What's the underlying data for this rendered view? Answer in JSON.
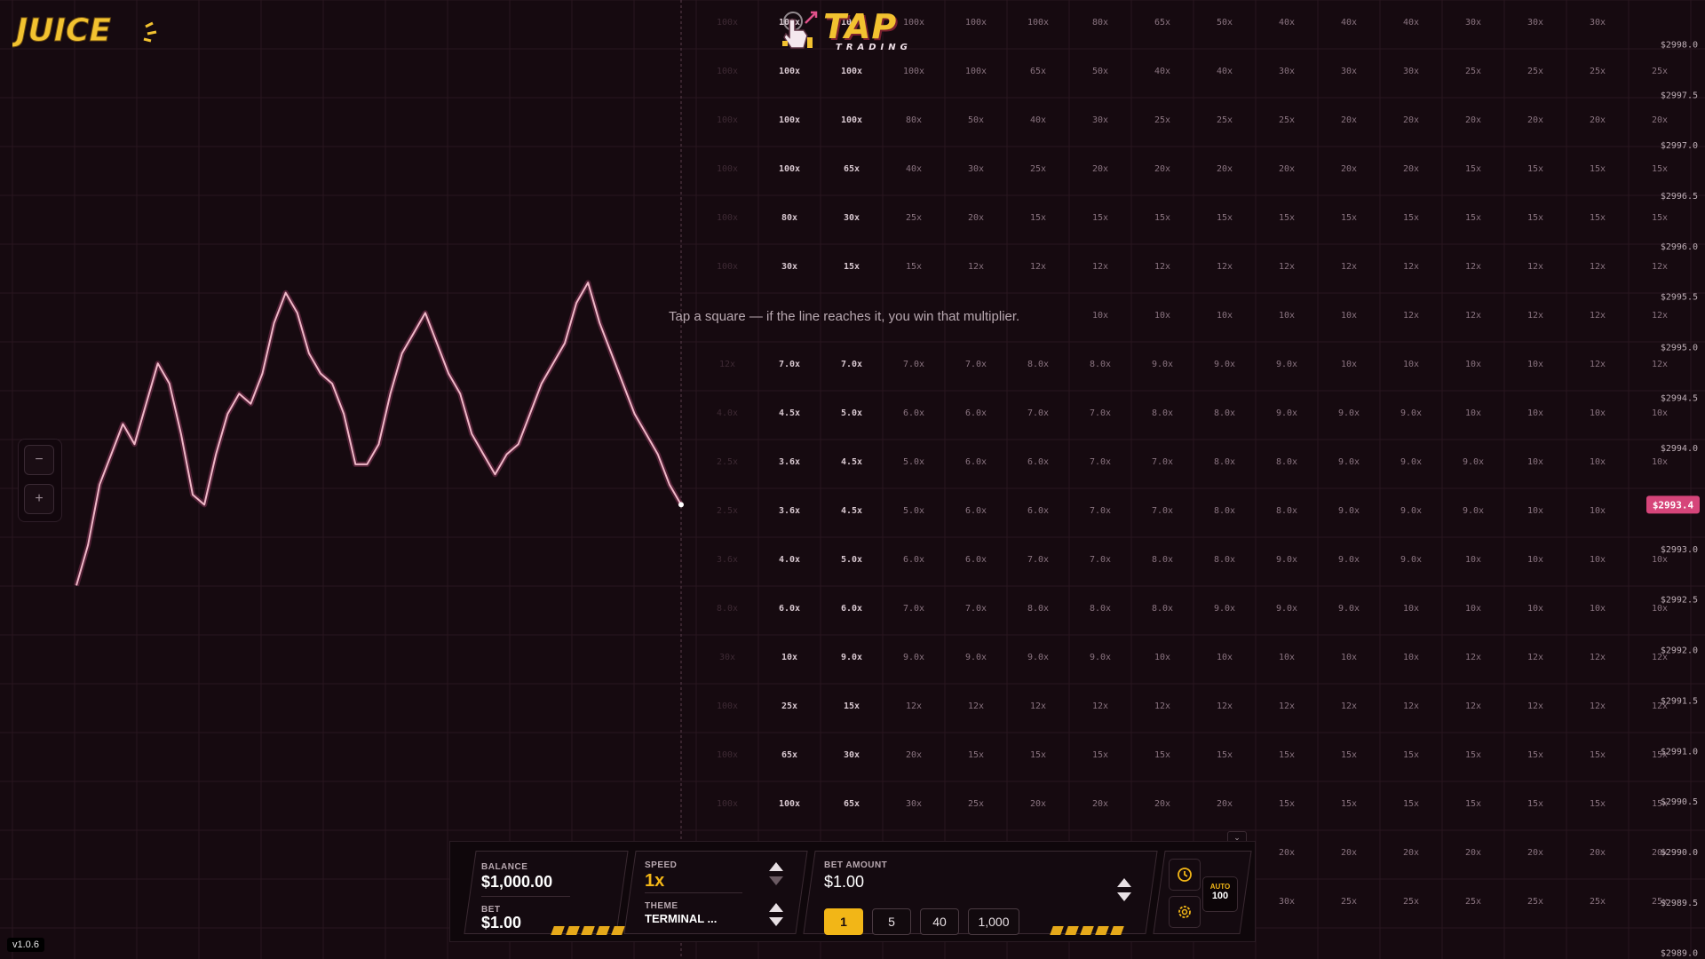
{
  "header": {
    "juice_logo_text": "JUICE",
    "tap_logo_text": "TAP",
    "tap_logo_sub": "TRADING"
  },
  "hint": "Tap a square — if the line reaches it, you win that multiplier.",
  "version": "v1.0.6",
  "current_price": "$2993.4",
  "price_labels": [
    "$2998.0",
    "$2997.5",
    "$2997.0",
    "$2996.5",
    "$2996.0",
    "$2995.5",
    "$2995.0",
    "$2994.5",
    "$2994.0",
    "$2993.0",
    "$2992.5",
    "$2992.0",
    "$2991.5",
    "$2991.0",
    "$2990.5",
    "$2990.0",
    "$2989.5",
    "$2989.0"
  ],
  "multiplier_rows": [
    [
      "100x",
      "100x",
      "100x",
      "100x",
      "100x",
      "80x",
      "65x",
      "50x",
      "40x",
      "40x",
      "40x",
      "30x",
      "30x",
      "30x"
    ],
    [
      "100x",
      "100x",
      "100x",
      "100x",
      "65x",
      "50x",
      "40x",
      "40x",
      "30x",
      "30x",
      "30x",
      "25x",
      "25x",
      "25x",
      "25x"
    ],
    [
      "100x",
      "100x",
      "80x",
      "50x",
      "40x",
      "30x",
      "25x",
      "25x",
      "25x",
      "20x",
      "20x",
      "20x",
      "20x",
      "20x",
      "20x"
    ],
    [
      "100x",
      "65x",
      "40x",
      "30x",
      "25x",
      "20x",
      "20x",
      "20x",
      "20x",
      "20x",
      "20x",
      "15x",
      "15x",
      "15x",
      "15x"
    ],
    [
      "80x",
      "30x",
      "25x",
      "20x",
      "15x",
      "15x",
      "15x",
      "15x",
      "15x",
      "15x",
      "15x",
      "15x",
      "15x",
      "15x",
      "15x"
    ],
    [
      "30x",
      "15x",
      "15x",
      "12x",
      "12x",
      "12x",
      "12x",
      "12x",
      "12x",
      "12x",
      "12x",
      "12x",
      "12x",
      "12x",
      "12x"
    ],
    [
      "",
      "",
      "",
      "",
      "",
      "10x",
      "10x",
      "10x",
      "10x",
      "10x",
      "12x",
      "12x",
      "12x",
      "12x",
      "12x"
    ],
    [
      "7.0x",
      "7.0x",
      "7.0x",
      "7.0x",
      "8.0x",
      "8.0x",
      "9.0x",
      "9.0x",
      "9.0x",
      "10x",
      "10x",
      "10x",
      "10x",
      "12x",
      "12x"
    ],
    [
      "4.5x",
      "5.0x",
      "6.0x",
      "6.0x",
      "7.0x",
      "7.0x",
      "8.0x",
      "8.0x",
      "9.0x",
      "9.0x",
      "9.0x",
      "10x",
      "10x",
      "10x",
      "10x"
    ],
    [
      "3.6x",
      "4.5x",
      "5.0x",
      "6.0x",
      "6.0x",
      "7.0x",
      "7.0x",
      "8.0x",
      "8.0x",
      "9.0x",
      "9.0x",
      "9.0x",
      "10x",
      "10x",
      "10x"
    ],
    [
      "3.6x",
      "4.5x",
      "5.0x",
      "6.0x",
      "6.0x",
      "7.0x",
      "7.0x",
      "8.0x",
      "8.0x",
      "9.0x",
      "9.0x",
      "9.0x",
      "10x",
      "10x",
      "10x"
    ],
    [
      "4.0x",
      "5.0x",
      "6.0x",
      "6.0x",
      "7.0x",
      "7.0x",
      "8.0x",
      "8.0x",
      "9.0x",
      "9.0x",
      "9.0x",
      "10x",
      "10x",
      "10x",
      "10x"
    ],
    [
      "6.0x",
      "6.0x",
      "7.0x",
      "7.0x",
      "8.0x",
      "8.0x",
      "8.0x",
      "9.0x",
      "9.0x",
      "9.0x",
      "10x",
      "10x",
      "10x",
      "10x",
      "10x"
    ],
    [
      "10x",
      "9.0x",
      "9.0x",
      "9.0x",
      "9.0x",
      "9.0x",
      "10x",
      "10x",
      "10x",
      "10x",
      "10x",
      "12x",
      "12x",
      "12x",
      "12x"
    ],
    [
      "25x",
      "15x",
      "12x",
      "12x",
      "12x",
      "12x",
      "12x",
      "12x",
      "12x",
      "12x",
      "12x",
      "12x",
      "12x",
      "12x",
      "12x"
    ],
    [
      "65x",
      "30x",
      "20x",
      "15x",
      "15x",
      "15x",
      "15x",
      "15x",
      "15x",
      "15x",
      "15x",
      "15x",
      "15x",
      "15x",
      "15x"
    ],
    [
      "100x",
      "65x",
      "30x",
      "25x",
      "20x",
      "20x",
      "20x",
      "20x",
      "15x",
      "15x",
      "15x",
      "15x",
      "15x",
      "15x",
      "15x"
    ],
    [
      "",
      "",
      "",
      "",
      "",
      "",
      "",
      "",
      "20x",
      "20x",
      "20x",
      "20x",
      "20x",
      "20x",
      "20x"
    ],
    [
      "",
      "",
      "",
      "",
      "",
      "",
      "",
      "",
      "30x",
      "25x",
      "25x",
      "25x",
      "25x",
      "25x",
      "25x"
    ]
  ],
  "faded_column": [
    "100x",
    "100x",
    "100x",
    "100x",
    "100x",
    "100x",
    "",
    "12x",
    "4.0x",
    "2.5x",
    "2.5x",
    "3.6x",
    "8.0x",
    "30x",
    "100x",
    "100x",
    "100x"
  ],
  "chart_data": {
    "type": "line",
    "series": [
      {
        "values": [
          2992.6,
          2993.0,
          2993.6,
          2993.9,
          2994.2,
          2994.0,
          2994.4,
          2994.8,
          2994.6,
          2994.1,
          2993.5,
          2993.4,
          2993.9,
          2994.3,
          2994.5,
          2994.4,
          2994.7,
          2995.2,
          2995.5,
          2995.3,
          2994.9,
          2994.7,
          2994.6,
          2994.3,
          2993.8,
          2993.8,
          2994.0,
          2994.5,
          2994.9,
          2995.1,
          2995.3,
          2995.0,
          2994.7,
          2994.5,
          2994.1,
          2993.9,
          2993.7,
          2993.9,
          2994.0,
          2994.3,
          2994.6,
          2994.8,
          2995.0,
          2995.4,
          2995.6,
          2995.2,
          2994.9,
          2994.6,
          2994.3,
          2994.1,
          2993.9,
          2993.6,
          2993.4
        ]
      }
    ],
    "ylim": [
      2988.9,
      2998.4
    ]
  },
  "controls": {
    "balance_label": "BALANCE",
    "balance_value": "$1,000.00",
    "bet_label": "BET",
    "bet_value": "$1.00",
    "speed_label": "SPEED",
    "speed_value": "1x",
    "theme_label": "THEME",
    "theme_value": "TERMINAL ...",
    "bet_amount_label": "BET AMOUNT",
    "bet_amount_value": "$1.00",
    "chips": [
      "1",
      "5",
      "40",
      "1,000"
    ],
    "active_chip": "1",
    "auto_label": "AUTO",
    "auto_value": "100"
  },
  "colors": {
    "accent": "#f2b617",
    "line": "#f0b8c8",
    "price_badge": "#d6457a",
    "background": "#160a10"
  }
}
